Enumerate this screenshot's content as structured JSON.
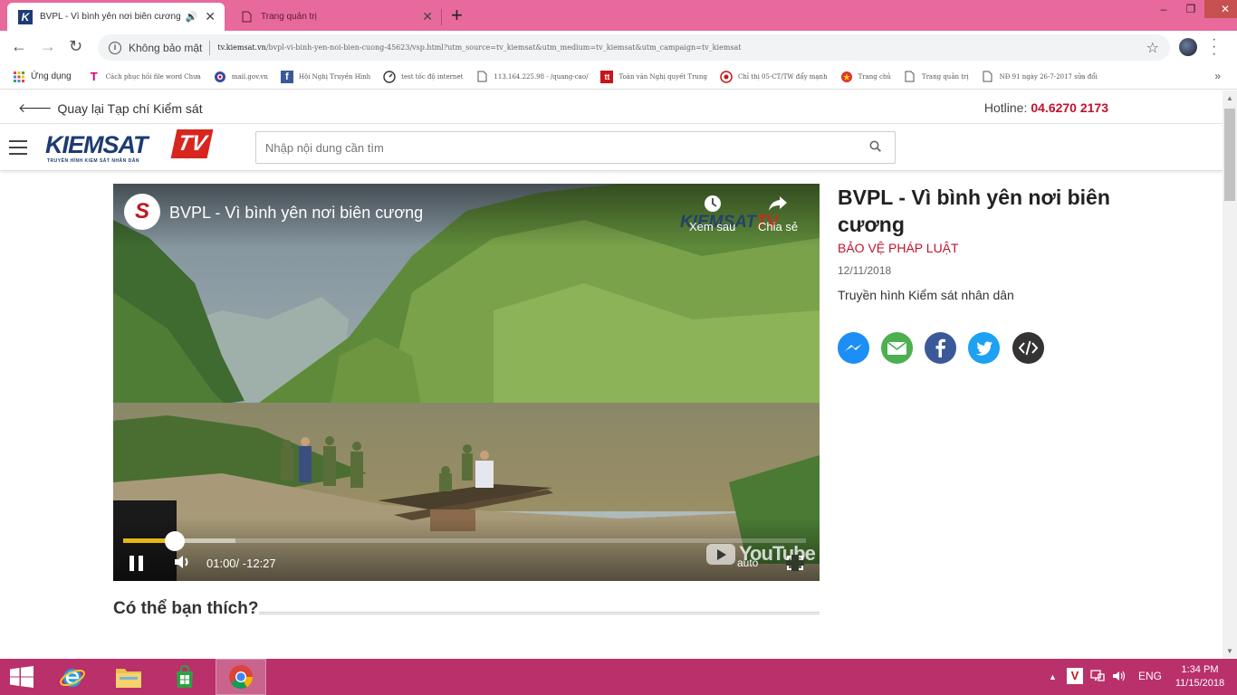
{
  "browser": {
    "tabs": [
      {
        "title": "BVPL - Vì bình yên nơi biên cương",
        "active": true
      },
      {
        "title": "Trang quản trị",
        "active": false
      }
    ],
    "security_label": "Không bảo mật",
    "url_domain": "tv.kiemsat.vn",
    "url_path": "/bvpl-vi-binh-yen-noi-bien-cuong-45623/vsp.html?utm_source=tv_kiemsat&utm_medium=tv_kiemsat&utm_campaign=tv_kiemsat",
    "bookmarks": [
      {
        "label": "Ứng dụng",
        "icon": "apps-grid-icon"
      },
      {
        "label": "Cách phục hồi file word Chưa",
        "icon": "t-icon"
      },
      {
        "label": "mail.gov.vn",
        "icon": "globe-icon"
      },
      {
        "label": "Hội Nghị Truyền Hình",
        "icon": "facebook-icon"
      },
      {
        "label": "test tốc độ internet",
        "icon": "speed-icon"
      },
      {
        "label": "113.164.225.98 - /quang-cao/",
        "icon": "page-icon"
      },
      {
        "label": "Toàn văn Nghị quyết Trung",
        "icon": "tt-icon"
      },
      {
        "label": "Chỉ thị 05-CT/TW đẩy mạnh",
        "icon": "ct-icon"
      },
      {
        "label": "Trang chủ",
        "icon": "emblem-icon"
      },
      {
        "label": "Trang quản trị",
        "icon": "page-icon"
      },
      {
        "label": "NĐ 91 ngày 26-7-2017 sửa đổi",
        "icon": "page-icon"
      }
    ]
  },
  "page": {
    "back_link": "Quay lại Tạp chí Kiểm sát",
    "hotline_label": "Hotline:",
    "hotline_number": "04.6270 2173",
    "logo_text": "KIEMSAT",
    "logo_tv": "TV",
    "logo_sub": "TRUYỀN HÌNH KIỂM SÁT NHÂN DÂN",
    "search_placeholder": "Nhập nội dung cần tìm"
  },
  "video": {
    "title": "BVPL - Vì bình yên nơi biên cương",
    "watermark_main": "KIEMSAT",
    "watermark_tv": "TV",
    "watch_later": "Xem sau",
    "share": "Chia sẻ",
    "time_current": "01:00/",
    "time_remaining": "-12:27",
    "progress_played_fraction": 0.075,
    "progress_buffered_fraction": 0.165,
    "youtube_label": "YouTube",
    "quality": "auto"
  },
  "article": {
    "title": "BVPL - Vì bình yên nơi biên cương",
    "category": "BẢO VỆ PHÁP LUẬT",
    "date": "12/11/2018",
    "source": "Truyền hình Kiểm sát nhân dân"
  },
  "share_buttons": [
    {
      "name": "messenger",
      "color": "#1d8ef5"
    },
    {
      "name": "email",
      "color": "#4caf50"
    },
    {
      "name": "facebook",
      "color": "#3b5998"
    },
    {
      "name": "twitter",
      "color": "#1da1f2"
    },
    {
      "name": "embed",
      "color": "#333333"
    }
  ],
  "related": {
    "heading": "Có thể bạn thích?"
  },
  "taskbar": {
    "language": "ENG",
    "time": "1:34 PM",
    "date": "11/15/2018"
  },
  "colors": {
    "tab_bar": "#e86a9c",
    "taskbar": "#b9306a",
    "accent_red": "#c0122c",
    "brand_blue": "#1d3b73",
    "progress_yellow": "#e6b812"
  }
}
